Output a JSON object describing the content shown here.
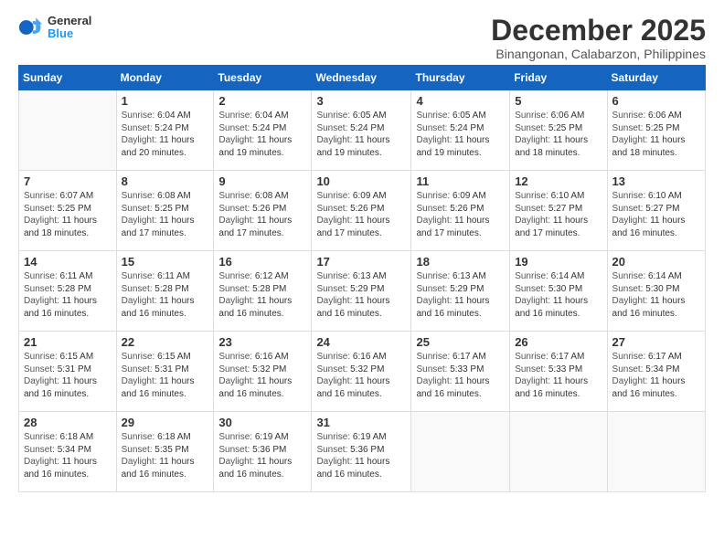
{
  "logo": {
    "line1": "General",
    "line2": "Blue"
  },
  "title": "December 2025",
  "subtitle": "Binangonan, Calabarzon, Philippines",
  "days_of_week": [
    "Sunday",
    "Monday",
    "Tuesday",
    "Wednesday",
    "Thursday",
    "Friday",
    "Saturday"
  ],
  "weeks": [
    [
      {
        "day": "",
        "sunrise": "",
        "sunset": "",
        "daylight": ""
      },
      {
        "day": "1",
        "sunrise": "6:04 AM",
        "sunset": "5:24 PM",
        "daylight": "11 hours and 20 minutes."
      },
      {
        "day": "2",
        "sunrise": "6:04 AM",
        "sunset": "5:24 PM",
        "daylight": "11 hours and 19 minutes."
      },
      {
        "day": "3",
        "sunrise": "6:05 AM",
        "sunset": "5:24 PM",
        "daylight": "11 hours and 19 minutes."
      },
      {
        "day": "4",
        "sunrise": "6:05 AM",
        "sunset": "5:24 PM",
        "daylight": "11 hours and 19 minutes."
      },
      {
        "day": "5",
        "sunrise": "6:06 AM",
        "sunset": "5:25 PM",
        "daylight": "11 hours and 18 minutes."
      },
      {
        "day": "6",
        "sunrise": "6:06 AM",
        "sunset": "5:25 PM",
        "daylight": "11 hours and 18 minutes."
      }
    ],
    [
      {
        "day": "7",
        "sunrise": "6:07 AM",
        "sunset": "5:25 PM",
        "daylight": "11 hours and 18 minutes."
      },
      {
        "day": "8",
        "sunrise": "6:08 AM",
        "sunset": "5:25 PM",
        "daylight": "11 hours and 17 minutes."
      },
      {
        "day": "9",
        "sunrise": "6:08 AM",
        "sunset": "5:26 PM",
        "daylight": "11 hours and 17 minutes."
      },
      {
        "day": "10",
        "sunrise": "6:09 AM",
        "sunset": "5:26 PM",
        "daylight": "11 hours and 17 minutes."
      },
      {
        "day": "11",
        "sunrise": "6:09 AM",
        "sunset": "5:26 PM",
        "daylight": "11 hours and 17 minutes."
      },
      {
        "day": "12",
        "sunrise": "6:10 AM",
        "sunset": "5:27 PM",
        "daylight": "11 hours and 17 minutes."
      },
      {
        "day": "13",
        "sunrise": "6:10 AM",
        "sunset": "5:27 PM",
        "daylight": "11 hours and 16 minutes."
      }
    ],
    [
      {
        "day": "14",
        "sunrise": "6:11 AM",
        "sunset": "5:28 PM",
        "daylight": "11 hours and 16 minutes."
      },
      {
        "day": "15",
        "sunrise": "6:11 AM",
        "sunset": "5:28 PM",
        "daylight": "11 hours and 16 minutes."
      },
      {
        "day": "16",
        "sunrise": "6:12 AM",
        "sunset": "5:28 PM",
        "daylight": "11 hours and 16 minutes."
      },
      {
        "day": "17",
        "sunrise": "6:13 AM",
        "sunset": "5:29 PM",
        "daylight": "11 hours and 16 minutes."
      },
      {
        "day": "18",
        "sunrise": "6:13 AM",
        "sunset": "5:29 PM",
        "daylight": "11 hours and 16 minutes."
      },
      {
        "day": "19",
        "sunrise": "6:14 AM",
        "sunset": "5:30 PM",
        "daylight": "11 hours and 16 minutes."
      },
      {
        "day": "20",
        "sunrise": "6:14 AM",
        "sunset": "5:30 PM",
        "daylight": "11 hours and 16 minutes."
      }
    ],
    [
      {
        "day": "21",
        "sunrise": "6:15 AM",
        "sunset": "5:31 PM",
        "daylight": "11 hours and 16 minutes."
      },
      {
        "day": "22",
        "sunrise": "6:15 AM",
        "sunset": "5:31 PM",
        "daylight": "11 hours and 16 minutes."
      },
      {
        "day": "23",
        "sunrise": "6:16 AM",
        "sunset": "5:32 PM",
        "daylight": "11 hours and 16 minutes."
      },
      {
        "day": "24",
        "sunrise": "6:16 AM",
        "sunset": "5:32 PM",
        "daylight": "11 hours and 16 minutes."
      },
      {
        "day": "25",
        "sunrise": "6:17 AM",
        "sunset": "5:33 PM",
        "daylight": "11 hours and 16 minutes."
      },
      {
        "day": "26",
        "sunrise": "6:17 AM",
        "sunset": "5:33 PM",
        "daylight": "11 hours and 16 minutes."
      },
      {
        "day": "27",
        "sunrise": "6:17 AM",
        "sunset": "5:34 PM",
        "daylight": "11 hours and 16 minutes."
      }
    ],
    [
      {
        "day": "28",
        "sunrise": "6:18 AM",
        "sunset": "5:34 PM",
        "daylight": "11 hours and 16 minutes."
      },
      {
        "day": "29",
        "sunrise": "6:18 AM",
        "sunset": "5:35 PM",
        "daylight": "11 hours and 16 minutes."
      },
      {
        "day": "30",
        "sunrise": "6:19 AM",
        "sunset": "5:36 PM",
        "daylight": "11 hours and 16 minutes."
      },
      {
        "day": "31",
        "sunrise": "6:19 AM",
        "sunset": "5:36 PM",
        "daylight": "11 hours and 16 minutes."
      },
      {
        "day": "",
        "sunrise": "",
        "sunset": "",
        "daylight": ""
      },
      {
        "day": "",
        "sunrise": "",
        "sunset": "",
        "daylight": ""
      },
      {
        "day": "",
        "sunrise": "",
        "sunset": "",
        "daylight": ""
      }
    ]
  ],
  "labels": {
    "sunrise": "Sunrise:",
    "sunset": "Sunset:",
    "daylight": "Daylight:"
  }
}
